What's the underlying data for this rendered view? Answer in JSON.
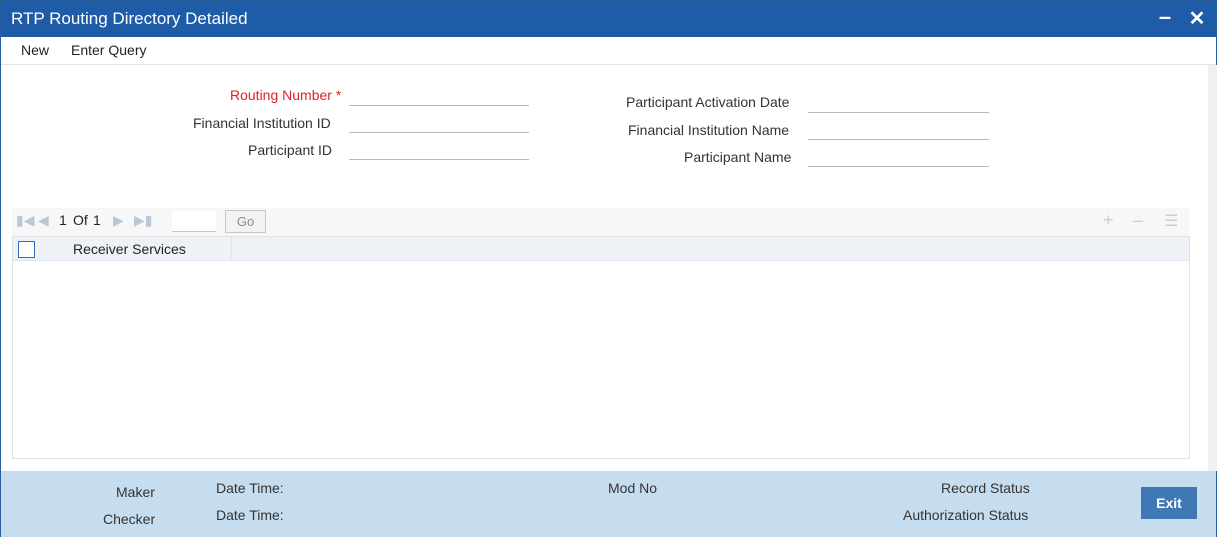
{
  "window": {
    "title": "RTP Routing Directory Detailed",
    "minimize_icon": "–",
    "close_icon": "✕"
  },
  "menu": {
    "items": [
      "New",
      "Enter Query"
    ]
  },
  "form": {
    "routing_number_label": "Routing Number",
    "required_marker": "*",
    "routing_number_value": "",
    "fi_id_label": "Financial Institution ID",
    "fi_id_value": "",
    "participant_id_label": "Participant ID",
    "participant_id_value": "",
    "activation_date_label": "Participant Activation Date",
    "activation_date_value": "",
    "fi_name_label": "Financial Institution Name",
    "fi_name_value": "",
    "participant_name_label": "Participant Name",
    "participant_name_value": ""
  },
  "pager": {
    "current": "1",
    "of_label": "Of",
    "total": "1",
    "go_label": "Go",
    "page_input_value": ""
  },
  "grid": {
    "columns": [
      "Receiver Services"
    ],
    "rows": []
  },
  "footer": {
    "maker_label": "Maker",
    "checker_label": "Checker",
    "date_time_label": "Date Time:",
    "mod_no_label": "Mod No",
    "record_status_label": "Record Status",
    "authorization_status_label": "Authorization Status",
    "exit_label": "Exit"
  },
  "colors": {
    "titlebar": "#1e5ca8",
    "required": "#e0202a",
    "footer": "#c6ddef",
    "exit_button": "#4078b5"
  }
}
